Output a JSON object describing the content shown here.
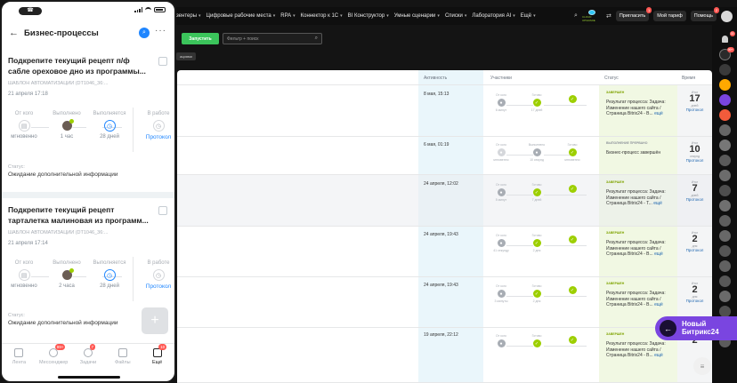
{
  "topbar": {
    "menu": [
      "зентеры",
      "Цифровые рабочие места",
      "RPA",
      "Коннектор к 1С",
      "BI Конструктор",
      "Умные сценарии",
      "Списки",
      "Лаборатория AI",
      "Ещё"
    ],
    "invite": "Пригласить",
    "invite_badge": "1",
    "tariff": "Мой тариф",
    "help": "Помощь",
    "help_badge": "2",
    "logo_text": "CLOUD UPGRADE"
  },
  "right_strip": {
    "badges": [
      "33",
      "99+"
    ]
  },
  "toolbar": {
    "run": "Запустить",
    "filter_placeholder": "Фильтр + поиск",
    "tag": "ациями"
  },
  "table": {
    "headers": {
      "activity": "Активность",
      "participants": "Участники",
      "status": "Статус",
      "time": "Время"
    },
    "rows": [
      {
        "activity": "8 мая, 15:13",
        "s1": "От кого",
        "s2": "Готово",
        "s1_sub": "6 минут",
        "s2_sub": "17 дней",
        "badge": "ЗАВЕРШЕН",
        "status": "Результат процесса: Задача: Изменение нашего сайта / Страница Bitrix24 - В...",
        "more": "ещё",
        "t1": "Итог",
        "t2": "17",
        "t3": "дней",
        "t4": "Протокол"
      },
      {
        "activity": "6 мая, 01:19",
        "s1": "От кого",
        "s2": "Выполнено",
        "s3": "Готово",
        "s1_sub": "мгновенно",
        "s2_sub": "10 секунд",
        "s3_sub": "мгновенно",
        "badge": "ВЫПОЛНЕНИЕ ПРЕРВАНО",
        "status": "Бизнес-процесс завершён",
        "more": "",
        "t1": "Итог",
        "t2": "10",
        "t3": "секунд",
        "t4": "Протокол"
      },
      {
        "activity": "24 апреля, 12:02",
        "s1": "От кого",
        "s2": "Готово",
        "s1_sub": "5 минут",
        "s2_sub": "7 дней",
        "badge": "ЗАВЕРШЕН",
        "status": "Результат процесса: Задача: Изменение нашего сайта / Страница Bitrix24 - Т...",
        "more": "ещё",
        "t1": "Итог",
        "t2": "7",
        "t3": "дней",
        "t4": "Протокол"
      },
      {
        "activity": "24 апреля, 19:43",
        "s1": "От кого",
        "s2": "Готово",
        "s1_sub": "41 секунду",
        "s2_sub": "2 дня",
        "badge": "ЗАВЕРШЕН",
        "status": "Результат процесса: Задача: Изменение нашего сайта / Страница Bitrix24 - В...",
        "more": "ещё",
        "t1": "Итог",
        "t2": "2",
        "t3": "дня",
        "t4": "Протокол"
      },
      {
        "activity": "24 апреля, 19:43",
        "s1": "От кого",
        "s2": "Готово",
        "s1_sub": "3 минуты",
        "s2_sub": "2 дня",
        "badge": "ЗАВЕРШЕН",
        "status": "Результат процесса: Задача: Изменение нашего сайта / Страница Bitrix24 - В...",
        "more": "ещё",
        "t1": "Итог",
        "t2": "2",
        "t3": "дня",
        "t4": "Протокол"
      },
      {
        "activity": "19 апреля, 22:12",
        "s1": "От кого",
        "s2": "Готово",
        "s1_sub": "",
        "s2_sub": "",
        "badge": "ЗАВЕРШЕН",
        "status": "Результат процесса: Задача: Изменение нашего сайта / Страница Bitrix24 - В...",
        "more": "ещё",
        "t1": "Итог",
        "t2": "2",
        "t3": "",
        "t4": ""
      }
    ]
  },
  "phone": {
    "status_pill": "☎",
    "title": "Бизнес-процессы",
    "cards": [
      {
        "title": "Подкрепите текущий рецепт п/ф сабле ореховое дно  из программы...",
        "meta": "ШАБЛОН АВТОМАТИЗАЦИИ (DT1046_36:...",
        "date": "21 апреля 17:18",
        "h1": "От кого",
        "h2": "Выполнено",
        "h3": "Выполняется",
        "h4": "В работе",
        "f1": "мгновенно",
        "f2": "1 час",
        "f3": "28 дней",
        "f4": "Протокол",
        "st_label": "Статус:",
        "st_value": "Ожидание дополнительной информации"
      },
      {
        "title": "Подкрепите текущий рецепт тарталетка малиновая  из программ...",
        "meta": "ШАБЛОН АВТОМАТИЗАЦИИ (DT1046_36:...",
        "date": "21 апреля 17:14",
        "h1": "От кого",
        "h2": "Выполнено",
        "h3": "Выполняется",
        "h4": "В работе",
        "f1": "мгновенно",
        "f2": "2 часа",
        "f3": "28 дней",
        "f4": "Протокол",
        "st_label": "Статус:",
        "st_value": "Ожидание дополнительной информации"
      }
    ],
    "tabs": [
      {
        "label": "Лента",
        "badge": ""
      },
      {
        "label": "Мессенджер",
        "badge": "99+"
      },
      {
        "label": "Задачи",
        "badge": "7"
      },
      {
        "label": "Файлы",
        "badge": ""
      },
      {
        "label": "Ещё",
        "badge": "10"
      }
    ]
  },
  "promo": {
    "line1": "Новый",
    "line2": "Битрикс24"
  },
  "colors": {
    "accent": "#3bc45b",
    "link": "#2067b0",
    "promo": "#7a45e0",
    "badge": "#ff5752"
  }
}
